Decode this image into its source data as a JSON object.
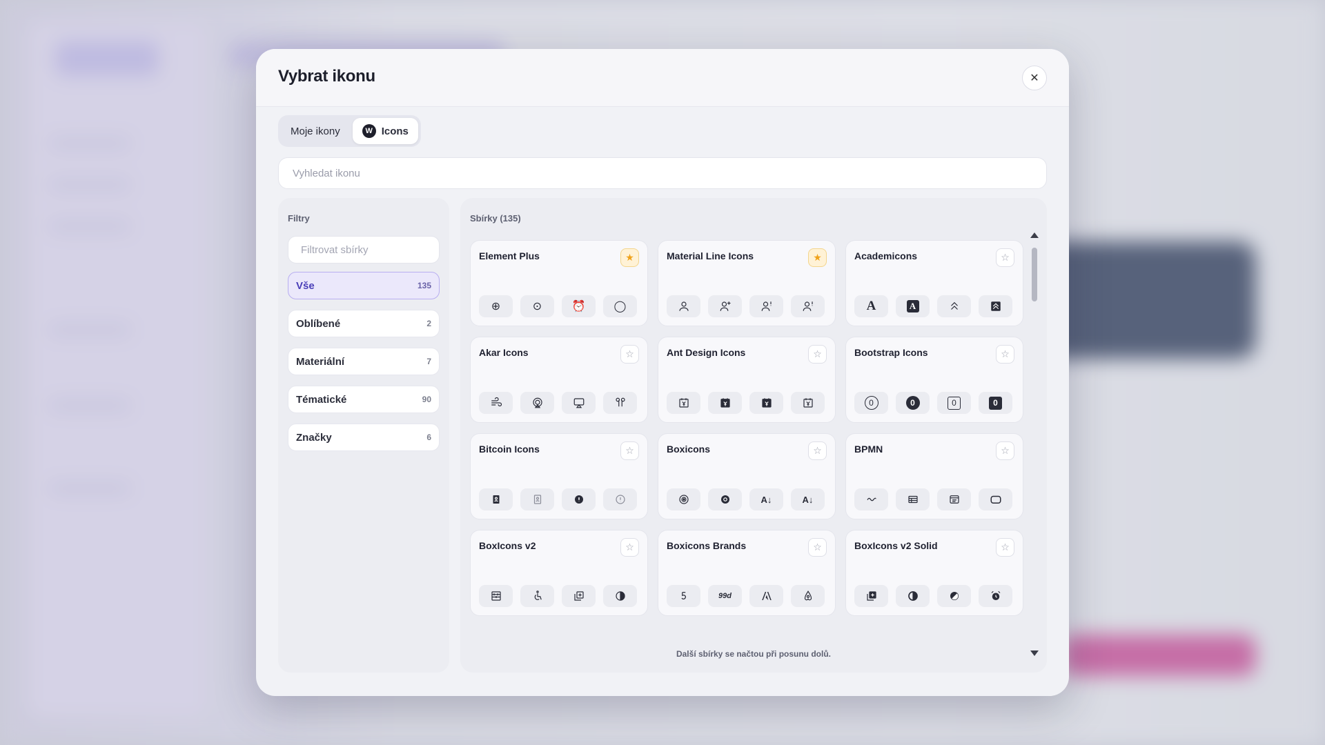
{
  "modal": {
    "title": "Vybrat ikonu",
    "close_label": "✕",
    "tabs": [
      {
        "label": "Moje ikony",
        "active": false
      },
      {
        "label": "Icons",
        "active": true
      }
    ],
    "search_placeholder": "Vyhledat ikonu"
  },
  "filters": {
    "title": "Filtry",
    "search_placeholder": "Filtrovat sbírky",
    "items": [
      {
        "label": "Vše",
        "count": "135",
        "active": true
      },
      {
        "label": "Oblíbené",
        "count": "2"
      },
      {
        "label": "Materiální",
        "count": "7"
      },
      {
        "label": "Tématické",
        "count": "90"
      },
      {
        "label": "Značky",
        "count": "6"
      }
    ]
  },
  "collections": {
    "title": "Sbírky (135)",
    "load_more": "Další sbírky se načtou při posunu dolů.",
    "cards": [
      {
        "name": "Element Plus",
        "favorite": true,
        "icons": [
          "location-icon",
          "crosshair-icon",
          "alarm-clock-icon",
          "apple-icon"
        ]
      },
      {
        "name": "Material Line Icons",
        "favorite": true,
        "icons": [
          "user-icon",
          "user-plus-icon",
          "user-alert-icon",
          "user-alert-icon"
        ]
      },
      {
        "name": "Academicons",
        "favorite": false,
        "icons": [
          "letter-a-icon",
          "letter-a-box-icon",
          "chevrons-up-icon",
          "chevrons-up-box-icon"
        ]
      },
      {
        "name": "Akar Icons",
        "favorite": false,
        "icons": [
          "wind-icon",
          "airplay-audio-icon",
          "airplay-video-icon",
          "airpods-icon"
        ]
      },
      {
        "name": "Ant Design Icons",
        "favorite": false,
        "icons": [
          "yuan-calendar-icon",
          "yuan-calendar-solid-icon",
          "yuan-calendar-solid-icon",
          "yuan-calendar-icon"
        ]
      },
      {
        "name": "Bootstrap Icons",
        "favorite": false,
        "icons": [
          "zero-circle-icon",
          "zero-circle-solid-icon",
          "zero-square-icon",
          "zero-square-solid-icon"
        ]
      },
      {
        "name": "Bitcoin Icons",
        "favorite": false,
        "icons": [
          "address-book-icon",
          "address-book-outline-icon",
          "alert-circle-icon",
          "alert-circle-outline-icon"
        ]
      },
      {
        "name": "Boxicons",
        "favorite": false,
        "icons": [
          "target-icon",
          "target-solid-icon",
          "sort-a-icon",
          "sort-a-solid-icon"
        ]
      },
      {
        "name": "BPMN",
        "favorite": false,
        "icons": [
          "wave-icon",
          "table-icon",
          "window-icon",
          "rounded-rect-icon"
        ]
      },
      {
        "name": "BoxIcons v2",
        "favorite": false,
        "icons": [
          "abacus-icon",
          "accessibility-icon",
          "add-layer-icon",
          "contrast-icon"
        ]
      },
      {
        "name": "Boxicons Brands",
        "favorite": false,
        "icons": [
          "brand-500px-icon",
          "brand-99designs-icon",
          "brand-adobe-icon",
          "brand-airbnb-icon"
        ]
      },
      {
        "name": "BoxIcons v2 Solid",
        "favorite": false,
        "icons": [
          "add-layer-solid-icon",
          "contrast-solid-icon",
          "contrast-alt-icon",
          "alarm-solid-icon"
        ]
      }
    ],
    "icon_glyphs": {
      "card0": [
        "⊕",
        "⊙",
        "⏰",
        "◯"
      ],
      "card1": [
        "👤",
        "👤⁺",
        "👤ⁱ",
        "👤ⁱ"
      ],
      "card2": [
        "A",
        "A",
        "⌃",
        "⌃"
      ],
      "card3": [
        "≋",
        "◎",
        "▭",
        "ꝡ"
      ],
      "card4": [
        "¥",
        "¥",
        "¥",
        "¥"
      ],
      "card5": [
        "0",
        "0",
        "0",
        "0"
      ],
      "card6": [
        "▤",
        "▤",
        "!",
        "ⓘ"
      ],
      "card7": [
        "◉",
        "◉",
        "A↓",
        "A↓"
      ],
      "card8": [
        "∼",
        "☰",
        "▣",
        "▢"
      ],
      "card9": [
        "▦",
        "♿",
        "⧉",
        "◐"
      ],
      "card10": [
        "₅",
        "99d",
        "Ⓐ",
        "⍝"
      ],
      "card11": [
        "⊞",
        "◐",
        "◑",
        "⏰"
      ]
    }
  }
}
